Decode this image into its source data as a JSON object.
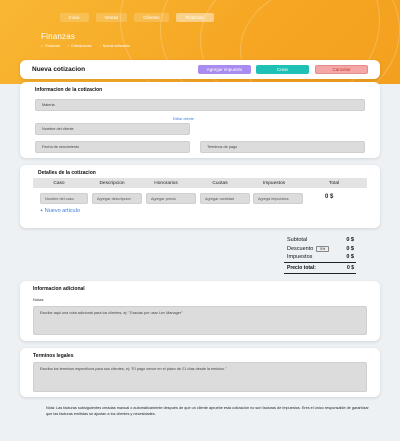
{
  "nav": {
    "items": [
      "Inicio",
      "Ventas",
      "Clientes",
      "Finanzas"
    ],
    "active_index": 3
  },
  "page": {
    "title": "Finanzas",
    "breadcrumbs": [
      "Finanzas",
      "Cotizaciones",
      "Nueva cotización"
    ]
  },
  "header": {
    "title": "Nueva cotizacion",
    "buttons": {
      "tax": "Agregar impuesto",
      "create": "Crear",
      "cancel": "Cancelar"
    }
  },
  "info": {
    "title": "Informacion de la cotizacion",
    "subject_placeholder": "Materia",
    "edit_client_link": "Editar cliente",
    "client_placeholder": "Nombre del cliente",
    "due_date_placeholder": "Fecha de vencimiento",
    "payment_terms_placeholder": "Terminos de pago"
  },
  "details": {
    "title": "Detalles de la cotizacion",
    "columns": [
      "Caso",
      "Descripcion",
      "Honorarios",
      "Cuotas",
      "Impuestos",
      "Total"
    ],
    "row": {
      "case_placeholder": "Nombre del caso",
      "description_placeholder": "Agregar descripcion",
      "fee_placeholder": "Agregar precio",
      "quantity_placeholder": "Agregar cantidad",
      "tax_placeholder": "Agrega impuestos",
      "total": "0 $"
    },
    "add_item": "+ Nuevo articulo"
  },
  "summary": {
    "subtotal_label": "Subtotal",
    "subtotal_value": "0 $",
    "discount_label": "Descuento",
    "discount_pct": "0%",
    "discount_value": "0 $",
    "taxes_label": "Impuestos",
    "taxes_value": "0 $",
    "total_label": "Precio total:",
    "total_value": "0 $"
  },
  "additional": {
    "title": "Informacion adicional",
    "notes_label": "Notas",
    "notes_placeholder": "Escribe aqui una nota adicional para los clientes, ej: \"Gracias por usar Lex Manager\""
  },
  "legal": {
    "title": "Terminos legales",
    "placeholder": "Escriba los terminos específicos  para sus clientes, ej: \"El pago vence en el plazo de 21 días  desde la emision.\""
  },
  "footnote": "Nota: Las facturas subsiguientes creadas manual o automáticamente después de que un cliente apruebe esta cotización no son facturas de impuestos. Eres el único responsable de garantizar que las facturas emitidas se ajustan a los clientes y necesidades.",
  "colors": {
    "accent": "#f6a623",
    "tax_button": "#a98cf0",
    "create_button": "#1fc0b5",
    "cancel_button": "#f5a6a6",
    "link": "#3b7dd8"
  }
}
